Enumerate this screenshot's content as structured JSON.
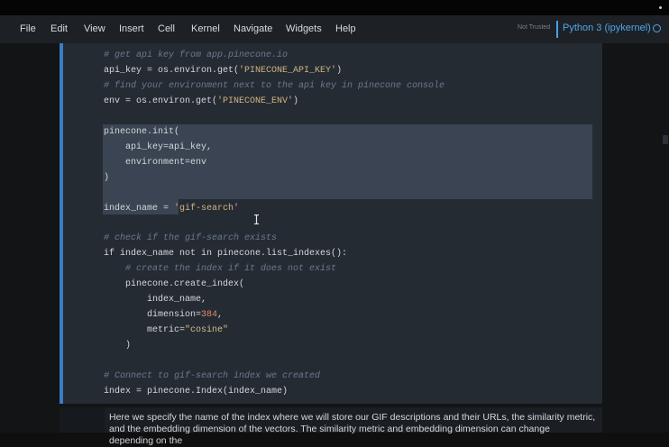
{
  "menu": {
    "items": [
      "File",
      "Edit",
      "View",
      "Insert",
      "Cell",
      "Kernel",
      "Navigate",
      "Widgets",
      "Help"
    ]
  },
  "status": {
    "trust": "Not Trusted",
    "kernel": "Python 3 (ipykernel)"
  },
  "code": {
    "lines": [
      {
        "type": "comment",
        "text": "# get api key from app.pinecone.io"
      },
      {
        "parts": [
          {
            "t": "api_key = os.environ.get("
          },
          {
            "t": "'PINECONE_API_KEY'",
            "c": "st"
          },
          {
            "t": ")"
          }
        ]
      },
      {
        "type": "comment",
        "text": "# find your environment next to the api key in pinecone console"
      },
      {
        "parts": [
          {
            "t": "env = os.environ.get("
          },
          {
            "t": "'PINECONE_ENV'",
            "c": "st"
          },
          {
            "t": ")"
          }
        ]
      },
      {
        "text": ""
      },
      {
        "text": "pinecone.init("
      },
      {
        "text": "    api_key=api_key,"
      },
      {
        "text": "    environment=env"
      },
      {
        "text": ")"
      },
      {
        "text": ""
      },
      {
        "parts": [
          {
            "t": "index_name = "
          },
          {
            "t": "'gif-search'",
            "c": "st"
          }
        ]
      },
      {
        "text": ""
      },
      {
        "type": "comment",
        "text": "# check if the gif-search exists"
      },
      {
        "parts": [
          {
            "t": "if index_name not in pinecone.list_indexes():"
          }
        ]
      },
      {
        "type": "comment",
        "text": "    # create the index if it does not exist"
      },
      {
        "text": "    pinecone.create_index("
      },
      {
        "text": "        index_name,"
      },
      {
        "parts": [
          {
            "t": "        dimension="
          },
          {
            "t": "384",
            "c": "nm"
          },
          {
            "t": ","
          }
        ]
      },
      {
        "parts": [
          {
            "t": "        metric="
          },
          {
            "t": "\"cosine\"",
            "c": "st2"
          }
        ]
      },
      {
        "text": "    )"
      },
      {
        "text": ""
      },
      {
        "type": "comment",
        "text": "# Connect to gif-search index we created"
      },
      {
        "text": "index = pinecone.Index(index_name)"
      }
    ]
  },
  "markdown": {
    "text": "Here we specify the name of the index where we will store our GIF descriptions and their URLs, the similarity metric, and the embedding dimension of the vectors. The similarity metric and embedding dimension can change depending on the"
  }
}
